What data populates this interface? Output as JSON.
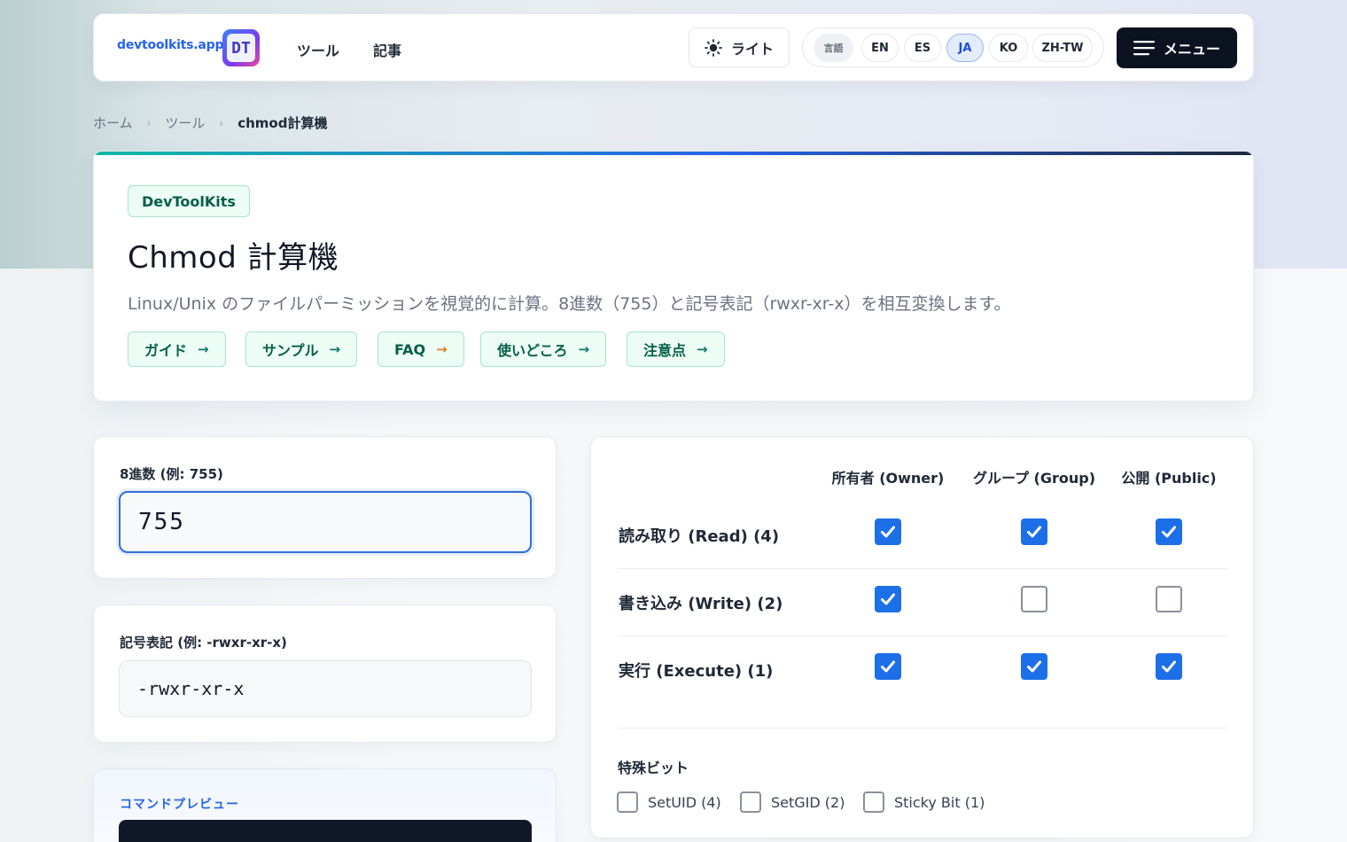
{
  "header": {
    "brand": "devtoolkits.app",
    "logo_text": "DT",
    "nav": [
      "ツール",
      "記事"
    ],
    "theme_label": "ライト",
    "language_label": "言語",
    "languages": [
      "EN",
      "ES",
      "JA",
      "KO",
      "ZH-TW"
    ],
    "active_language": "JA",
    "menu_label": "メニュー"
  },
  "breadcrumb": {
    "items": [
      "ホーム",
      "ツール",
      "chmod計算機"
    ],
    "separator": "›"
  },
  "hero": {
    "tag": "DevToolKits",
    "title": "Chmod 計算機",
    "description": "Linux/Unix のファイルパーミッションを視覚的に計算。8進数（755）と記号表記（rwxr-xr-x）を相互変換します。",
    "chips": [
      "ガイド",
      "サンプル",
      "FAQ",
      "使いどころ",
      "注意点"
    ],
    "chip_arrow": "→"
  },
  "octal": {
    "label": "8進数 (例: 755)",
    "value": "755"
  },
  "symbolic": {
    "label": "記号表記 (例: -rwxr-xr-x)",
    "value": "-rwxr-xr-x"
  },
  "preview": {
    "title": "コマンドプレビュー"
  },
  "matrix": {
    "columns": [
      "所有者 (Owner)",
      "グループ (Group)",
      "公開 (Public)"
    ],
    "rows": [
      {
        "label": "読み取り (Read) (4)",
        "values": [
          true,
          true,
          true
        ]
      },
      {
        "label": "書き込み (Write) (2)",
        "values": [
          true,
          false,
          false
        ]
      },
      {
        "label": "実行 (Execute) (1)",
        "values": [
          true,
          true,
          true
        ]
      }
    ]
  },
  "special": {
    "title": "特殊ビット",
    "items": [
      {
        "label": "SetUID (4)",
        "checked": false
      },
      {
        "label": "SetGID (2)",
        "checked": false
      },
      {
        "label": "Sticky Bit (1)",
        "checked": false
      }
    ]
  },
  "colors": {
    "accent": "#2563eb",
    "checkbox": "#1d6fe8",
    "chip_bg": "#ecfdf5",
    "chip_text": "#065f46",
    "menu_bg": "#0b1220"
  }
}
